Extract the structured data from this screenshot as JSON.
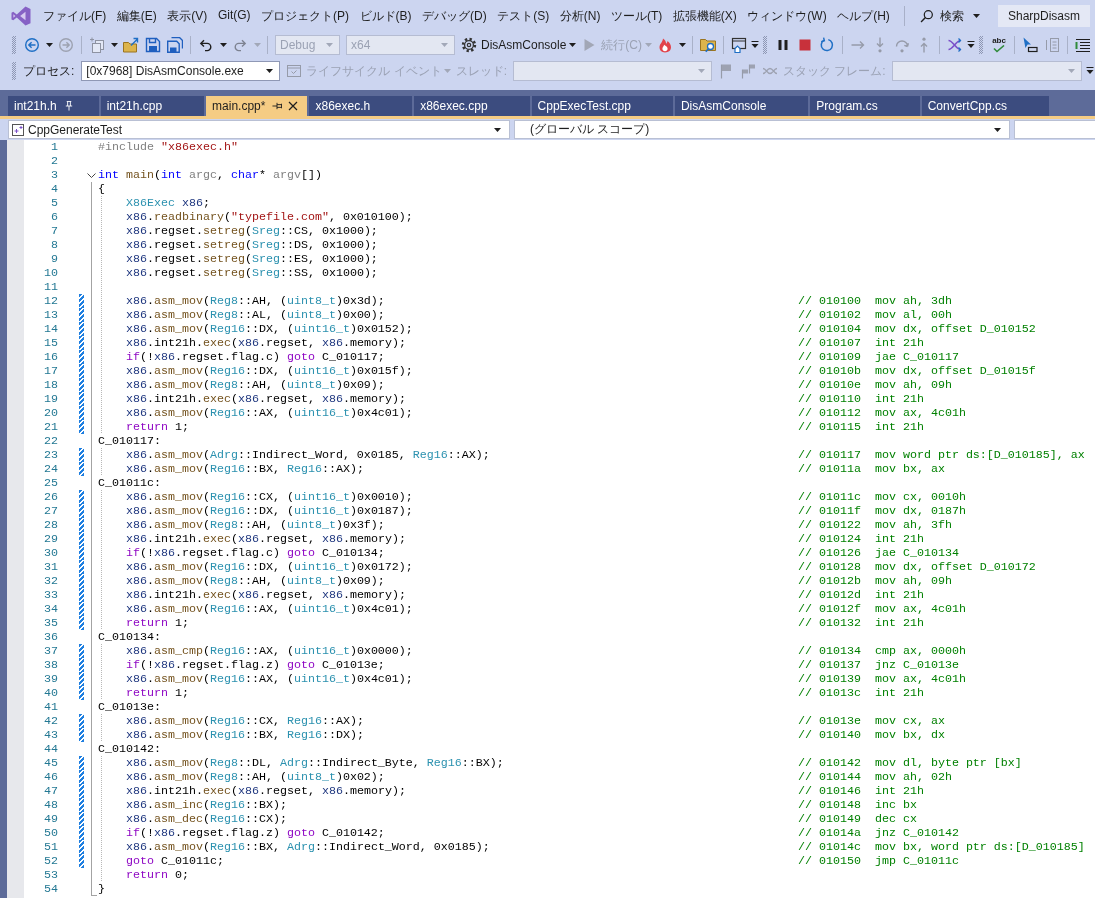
{
  "menu": {
    "items": [
      "ファイル(F)",
      "編集(E)",
      "表示(V)",
      "Git(G)",
      "プロジェクト(P)",
      "ビルド(B)",
      "デバッグ(D)",
      "テスト(S)",
      "分析(N)",
      "ツール(T)",
      "拡張機能(X)",
      "ウィンドウ(W)",
      "ヘルプ(H)"
    ],
    "search": "検索",
    "solution": "SharpDisasm"
  },
  "toolbar": [
    {
      "kind": "grip"
    },
    {
      "kind": "button",
      "disabled": false
    },
    {
      "kind": "caret",
      "disabled": false
    },
    {
      "kind": "button",
      "disabled": true
    },
    {
      "kind": "separator"
    },
    {
      "kind": "button",
      "disabled": true
    },
    {
      "kind": "caret",
      "disabled": false
    },
    {
      "kind": "button",
      "disabled": false
    },
    {
      "kind": "button",
      "disabled": false
    },
    {
      "kind": "button",
      "disabled": false
    },
    {
      "kind": "separator"
    },
    {
      "kind": "button",
      "disabled": false
    },
    {
      "kind": "caret",
      "disabled": false
    },
    {
      "kind": "button",
      "disabled": true
    },
    {
      "kind": "caret",
      "disabled": true
    },
    {
      "kind": "separator"
    },
    {
      "kind": "combo",
      "value": "Debug",
      "disabled": true
    },
    {
      "kind": "combo",
      "value": "x64",
      "disabled": true
    },
    {
      "kind": "text_button",
      "label": "DisAsmConsole",
      "disabled": false
    },
    {
      "kind": "caret",
      "disabled": false
    },
    {
      "kind": "text_button",
      "label": "続行(C)",
      "disabled": true
    },
    {
      "kind": "caret",
      "disabled": true
    },
    {
      "kind": "button",
      "disabled": false
    },
    {
      "kind": "caret",
      "disabled": false
    },
    {
      "kind": "separator"
    },
    {
      "kind": "button",
      "disabled": false
    },
    {
      "kind": "separator"
    },
    {
      "kind": "button",
      "disabled": false
    },
    {
      "kind": "overflow"
    },
    {
      "kind": "grip"
    },
    {
      "kind": "button",
      "disabled": false
    },
    {
      "kind": "button",
      "disabled": false
    },
    {
      "kind": "button",
      "disabled": false
    },
    {
      "kind": "separator"
    },
    {
      "kind": "button",
      "disabled": true
    },
    {
      "kind": "button",
      "disabled": true
    },
    {
      "kind": "button",
      "disabled": true
    },
    {
      "kind": "button",
      "disabled": true
    },
    {
      "kind": "separator"
    },
    {
      "kind": "button",
      "disabled": false
    },
    {
      "kind": "overflow"
    },
    {
      "kind": "grip"
    },
    {
      "kind": "stacked",
      "label": "abc",
      "disabled": false
    },
    {
      "kind": "separator"
    },
    {
      "kind": "button",
      "disabled": false
    },
    {
      "kind": "button",
      "disabled": true
    },
    {
      "kind": "separator"
    },
    {
      "kind": "button",
      "disabled": false
    }
  ],
  "debug_toolbar": [
    {
      "kind": "grip"
    },
    {
      "kind": "label",
      "text": "プロセス:",
      "disabled": false
    },
    {
      "kind": "combo",
      "value": "[0x7968] DisAsmConsole.exe",
      "disabled": false
    },
    {
      "kind": "text_button",
      "label": "ライフサイクル イベント",
      "disabled": true
    },
    {
      "kind": "caret",
      "disabled": true
    },
    {
      "kind": "label",
      "text": "スレッド:",
      "disabled": true
    },
    {
      "kind": "combo",
      "disabled": true
    },
    {
      "kind": "button",
      "disabled": true
    },
    {
      "kind": "button",
      "disabled": true
    },
    {
      "kind": "button",
      "disabled": true
    },
    {
      "kind": "label",
      "text": "スタック フレーム:",
      "disabled": true
    },
    {
      "kind": "combo",
      "disabled": true
    },
    {
      "kind": "overflow"
    }
  ],
  "tabs": [
    {
      "label": "int21h.h",
      "selected": false,
      "pinned": true
    },
    {
      "label": "int21h.cpp",
      "selected": false,
      "pinned": false
    },
    {
      "label": "main.cpp*",
      "selected": true,
      "pinned": false
    },
    {
      "label": "x86exec.h",
      "selected": false,
      "pinned": false
    },
    {
      "label": "x86exec.cpp",
      "selected": false,
      "pinned": false
    },
    {
      "label": "CppExecTest.cpp",
      "selected": false,
      "pinned": false
    },
    {
      "label": "DisAsmConsole",
      "selected": false,
      "pinned": false
    },
    {
      "label": "Program.cs",
      "selected": false,
      "pinned": false
    },
    {
      "label": "ConvertCpp.cs",
      "selected": false,
      "pinned": false
    }
  ],
  "navigation_bar": {
    "project": "CppGenerateTest",
    "scope": "(グローバル スコープ)"
  },
  "editor": {
    "lines": [
      {
        "number": "1",
        "changed": false,
        "indented": false,
        "code": [
          {
            "kind": "directive",
            "text": "#include"
          },
          {
            "kind": "string",
            "text": " \"x86exec.h\""
          }
        ]
      },
      {
        "number": "2",
        "changed": false,
        "indented": false
      },
      {
        "number": "3",
        "changed": false,
        "indented": false,
        "expanded": true,
        "code": [
          {
            "kind": "keyword",
            "text": "int"
          },
          {
            "kind": "function",
            "text": " main"
          },
          {
            "kind": "plain",
            "text": "("
          },
          {
            "kind": "keyword",
            "text": "int"
          },
          {
            "kind": "parameter",
            "text": " argc"
          },
          {
            "kind": "plain",
            "text": ", "
          },
          {
            "kind": "keyword",
            "text": "char"
          },
          {
            "kind": "plain",
            "text": "* "
          },
          {
            "kind": "parameter",
            "text": "argv"
          },
          {
            "kind": "plain",
            "text": "[])"
          }
        ]
      },
      {
        "number": "4",
        "changed": false,
        "indented": false,
        "code": [
          {
            "kind": "plain",
            "text": "{"
          }
        ]
      },
      {
        "number": "5",
        "changed": false,
        "indented": true,
        "code": [
          {
            "kind": "type",
            "text": "X86Exec"
          },
          {
            "kind": "variable",
            "text": " x86"
          },
          {
            "kind": "plain",
            "text": ";"
          }
        ]
      },
      {
        "number": "6",
        "changed": false,
        "indented": true,
        "code": [
          {
            "kind": "variable",
            "text": "x86"
          },
          {
            "kind": "plain",
            "text": "."
          },
          {
            "kind": "function",
            "text": "readbinary"
          },
          {
            "kind": "plain",
            "text": "("
          },
          {
            "kind": "string",
            "text": "\"typefile.com\""
          },
          {
            "kind": "plain",
            "text": ", 0x010100);"
          }
        ]
      },
      {
        "number": "7",
        "changed": false,
        "indented": true,
        "code": [
          {
            "kind": "variable",
            "text": "x86"
          },
          {
            "kind": "plain",
            "text": ".regset."
          },
          {
            "kind": "function",
            "text": "setreg"
          },
          {
            "kind": "plain",
            "text": "("
          },
          {
            "kind": "type",
            "text": "Sreg"
          },
          {
            "kind": "plain",
            "text": "::CS, 0x1000);"
          }
        ]
      },
      {
        "number": "8",
        "changed": false,
        "indented": true,
        "code": [
          {
            "kind": "variable",
            "text": "x86"
          },
          {
            "kind": "plain",
            "text": ".regset."
          },
          {
            "kind": "function",
            "text": "setreg"
          },
          {
            "kind": "plain",
            "text": "("
          },
          {
            "kind": "type",
            "text": "Sreg"
          },
          {
            "kind": "plain",
            "text": "::DS, 0x1000);"
          }
        ]
      },
      {
        "number": "9",
        "changed": false,
        "indented": true,
        "code": [
          {
            "kind": "variable",
            "text": "x86"
          },
          {
            "kind": "plain",
            "text": ".regset."
          },
          {
            "kind": "function",
            "text": "setreg"
          },
          {
            "kind": "plain",
            "text": "("
          },
          {
            "kind": "type",
            "text": "Sreg"
          },
          {
            "kind": "plain",
            "text": "::ES, 0x1000);"
          }
        ]
      },
      {
        "number": "10",
        "changed": false,
        "indented": true,
        "code": [
          {
            "kind": "variable",
            "text": "x86"
          },
          {
            "kind": "plain",
            "text": ".regset."
          },
          {
            "kind": "function",
            "text": "setreg"
          },
          {
            "kind": "plain",
            "text": "("
          },
          {
            "kind": "type",
            "text": "Sreg"
          },
          {
            "kind": "plain",
            "text": "::SS, 0x1000);"
          }
        ]
      },
      {
        "number": "11",
        "changed": false,
        "indented": true
      },
      {
        "number": "12",
        "changed": true,
        "indented": true,
        "code": [
          {
            "kind": "variable",
            "text": "x86"
          },
          {
            "kind": "plain",
            "text": "."
          },
          {
            "kind": "function",
            "text": "asm_mov"
          },
          {
            "kind": "plain",
            "text": "("
          },
          {
            "kind": "type",
            "text": "Reg8"
          },
          {
            "kind": "plain",
            "text": "::AH, ("
          },
          {
            "kind": "type",
            "text": "uint8_t"
          },
          {
            "kind": "plain",
            "text": ")0x3d);"
          }
        ],
        "comment": "// 010100  mov ah, 3dh"
      },
      {
        "number": "13",
        "changed": true,
        "indented": true,
        "code": [
          {
            "kind": "variable",
            "text": "x86"
          },
          {
            "kind": "plain",
            "text": "."
          },
          {
            "kind": "function",
            "text": "asm_mov"
          },
          {
            "kind": "plain",
            "text": "("
          },
          {
            "kind": "type",
            "text": "Reg8"
          },
          {
            "kind": "plain",
            "text": "::AL, ("
          },
          {
            "kind": "type",
            "text": "uint8_t"
          },
          {
            "kind": "plain",
            "text": ")0x00);"
          }
        ],
        "comment": "// 010102  mov al, 00h"
      },
      {
        "number": "14",
        "changed": true,
        "indented": true,
        "code": [
          {
            "kind": "variable",
            "text": "x86"
          },
          {
            "kind": "plain",
            "text": "."
          },
          {
            "kind": "function",
            "text": "asm_mov"
          },
          {
            "kind": "plain",
            "text": "("
          },
          {
            "kind": "type",
            "text": "Reg16"
          },
          {
            "kind": "plain",
            "text": "::DX, ("
          },
          {
            "kind": "type",
            "text": "uint16_t"
          },
          {
            "kind": "plain",
            "text": ")0x0152);"
          }
        ],
        "comment": "// 010104  mov dx, offset D_010152"
      },
      {
        "number": "15",
        "changed": true,
        "indented": true,
        "code": [
          {
            "kind": "variable",
            "text": "x86"
          },
          {
            "kind": "plain",
            "text": ".int21h."
          },
          {
            "kind": "function",
            "text": "exec"
          },
          {
            "kind": "plain",
            "text": "("
          },
          {
            "kind": "variable",
            "text": "x86"
          },
          {
            "kind": "plain",
            "text": ".regset, "
          },
          {
            "kind": "variable",
            "text": "x86"
          },
          {
            "kind": "plain",
            "text": ".memory);"
          }
        ],
        "comment": "// 010107  int 21h"
      },
      {
        "number": "16",
        "changed": true,
        "indented": true,
        "code": [
          {
            "kind": "control",
            "text": "if"
          },
          {
            "kind": "plain",
            "text": "(!"
          },
          {
            "kind": "variable",
            "text": "x86"
          },
          {
            "kind": "plain",
            "text": ".regset.flag.c) "
          },
          {
            "kind": "control",
            "text": "goto"
          },
          {
            "kind": "plain",
            "text": " C_010117;"
          }
        ],
        "comment": "// 010109  jae C_010117"
      },
      {
        "number": "17",
        "changed": true,
        "indented": true,
        "code": [
          {
            "kind": "variable",
            "text": "x86"
          },
          {
            "kind": "plain",
            "text": "."
          },
          {
            "kind": "function",
            "text": "asm_mov"
          },
          {
            "kind": "plain",
            "text": "("
          },
          {
            "kind": "type",
            "text": "Reg16"
          },
          {
            "kind": "plain",
            "text": "::DX, ("
          },
          {
            "kind": "type",
            "text": "uint16_t"
          },
          {
            "kind": "plain",
            "text": ")0x015f);"
          }
        ],
        "comment": "// 01010b  mov dx, offset D_01015f"
      },
      {
        "number": "18",
        "changed": true,
        "indented": true,
        "code": [
          {
            "kind": "variable",
            "text": "x86"
          },
          {
            "kind": "plain",
            "text": "."
          },
          {
            "kind": "function",
            "text": "asm_mov"
          },
          {
            "kind": "plain",
            "text": "("
          },
          {
            "kind": "type",
            "text": "Reg8"
          },
          {
            "kind": "plain",
            "text": "::AH, ("
          },
          {
            "kind": "type",
            "text": "uint8_t"
          },
          {
            "kind": "plain",
            "text": ")0x09);"
          }
        ],
        "comment": "// 01010e  mov ah, 09h"
      },
      {
        "number": "19",
        "changed": true,
        "indented": true,
        "code": [
          {
            "kind": "variable",
            "text": "x86"
          },
          {
            "kind": "plain",
            "text": ".int21h."
          },
          {
            "kind": "function",
            "text": "exec"
          },
          {
            "kind": "plain",
            "text": "("
          },
          {
            "kind": "variable",
            "text": "x86"
          },
          {
            "kind": "plain",
            "text": ".regset, "
          },
          {
            "kind": "variable",
            "text": "x86"
          },
          {
            "kind": "plain",
            "text": ".memory);"
          }
        ],
        "comment": "// 010110  int 21h"
      },
      {
        "number": "20",
        "changed": true,
        "indented": true,
        "code": [
          {
            "kind": "variable",
            "text": "x86"
          },
          {
            "kind": "plain",
            "text": "."
          },
          {
            "kind": "function",
            "text": "asm_mov"
          },
          {
            "kind": "plain",
            "text": "("
          },
          {
            "kind": "type",
            "text": "Reg16"
          },
          {
            "kind": "plain",
            "text": "::AX, ("
          },
          {
            "kind": "type",
            "text": "uint16_t"
          },
          {
            "kind": "plain",
            "text": ")0x4c01);"
          }
        ],
        "comment": "// 010112  mov ax, 4c01h"
      },
      {
        "number": "21",
        "changed": true,
        "indented": true,
        "code": [
          {
            "kind": "control",
            "text": "return"
          },
          {
            "kind": "plain",
            "text": " 1;"
          }
        ],
        "comment": "// 010115  int 21h"
      },
      {
        "number": "22",
        "changed": false,
        "indented": false,
        "code": [
          {
            "kind": "plain",
            "text": "C_010117:"
          }
        ]
      },
      {
        "number": "23",
        "changed": true,
        "indented": true,
        "code": [
          {
            "kind": "variable",
            "text": "x86"
          },
          {
            "kind": "plain",
            "text": "."
          },
          {
            "kind": "function",
            "text": "asm_mov"
          },
          {
            "kind": "plain",
            "text": "("
          },
          {
            "kind": "type",
            "text": "Adrg"
          },
          {
            "kind": "plain",
            "text": "::Indirect_Word, 0x0185, "
          },
          {
            "kind": "type",
            "text": "Reg16"
          },
          {
            "kind": "plain",
            "text": "::AX);"
          }
        ],
        "comment": "// 010117  mov word ptr ds:[D_010185], ax"
      },
      {
        "number": "24",
        "changed": true,
        "indented": true,
        "code": [
          {
            "kind": "variable",
            "text": "x86"
          },
          {
            "kind": "plain",
            "text": "."
          },
          {
            "kind": "function",
            "text": "asm_mov"
          },
          {
            "kind": "plain",
            "text": "("
          },
          {
            "kind": "type",
            "text": "Reg16"
          },
          {
            "kind": "plain",
            "text": "::BX, "
          },
          {
            "kind": "type",
            "text": "Reg16"
          },
          {
            "kind": "plain",
            "text": "::AX);"
          }
        ],
        "comment": "// 01011a  mov bx, ax"
      },
      {
        "number": "25",
        "changed": false,
        "indented": false,
        "code": [
          {
            "kind": "plain",
            "text": "C_01011c:"
          }
        ]
      },
      {
        "number": "26",
        "changed": true,
        "indented": true,
        "code": [
          {
            "kind": "variable",
            "text": "x86"
          },
          {
            "kind": "plain",
            "text": "."
          },
          {
            "kind": "function",
            "text": "asm_mov"
          },
          {
            "kind": "plain",
            "text": "("
          },
          {
            "kind": "type",
            "text": "Reg16"
          },
          {
            "kind": "plain",
            "text": "::CX, ("
          },
          {
            "kind": "type",
            "text": "uint16_t"
          },
          {
            "kind": "plain",
            "text": ")0x0010);"
          }
        ],
        "comment": "// 01011c  mov cx, 0010h"
      },
      {
        "number": "27",
        "changed": true,
        "indented": true,
        "code": [
          {
            "kind": "variable",
            "text": "x86"
          },
          {
            "kind": "plain",
            "text": "."
          },
          {
            "kind": "function",
            "text": "asm_mov"
          },
          {
            "kind": "plain",
            "text": "("
          },
          {
            "kind": "type",
            "text": "Reg16"
          },
          {
            "kind": "plain",
            "text": "::DX, ("
          },
          {
            "kind": "type",
            "text": "uint16_t"
          },
          {
            "kind": "plain",
            "text": ")0x0187);"
          }
        ],
        "comment": "// 01011f  mov dx, 0187h"
      },
      {
        "number": "28",
        "changed": true,
        "indented": true,
        "code": [
          {
            "kind": "variable",
            "text": "x86"
          },
          {
            "kind": "plain",
            "text": "."
          },
          {
            "kind": "function",
            "text": "asm_mov"
          },
          {
            "kind": "plain",
            "text": "("
          },
          {
            "kind": "type",
            "text": "Reg8"
          },
          {
            "kind": "plain",
            "text": "::AH, ("
          },
          {
            "kind": "type",
            "text": "uint8_t"
          },
          {
            "kind": "plain",
            "text": ")0x3f);"
          }
        ],
        "comment": "// 010122  mov ah, 3fh"
      },
      {
        "number": "29",
        "changed": true,
        "indented": true,
        "code": [
          {
            "kind": "variable",
            "text": "x86"
          },
          {
            "kind": "plain",
            "text": ".int21h."
          },
          {
            "kind": "function",
            "text": "exec"
          },
          {
            "kind": "plain",
            "text": "("
          },
          {
            "kind": "variable",
            "text": "x86"
          },
          {
            "kind": "plain",
            "text": ".regset, "
          },
          {
            "kind": "variable",
            "text": "x86"
          },
          {
            "kind": "plain",
            "text": ".memory);"
          }
        ],
        "comment": "// 010124  int 21h"
      },
      {
        "number": "30",
        "changed": true,
        "indented": true,
        "code": [
          {
            "kind": "control",
            "text": "if"
          },
          {
            "kind": "plain",
            "text": "(!"
          },
          {
            "kind": "variable",
            "text": "x86"
          },
          {
            "kind": "plain",
            "text": ".regset.flag.c) "
          },
          {
            "kind": "control",
            "text": "goto"
          },
          {
            "kind": "plain",
            "text": " C_010134;"
          }
        ],
        "comment": "// 010126  jae C_010134"
      },
      {
        "number": "31",
        "changed": true,
        "indented": true,
        "code": [
          {
            "kind": "variable",
            "text": "x86"
          },
          {
            "kind": "plain",
            "text": "."
          },
          {
            "kind": "function",
            "text": "asm_mov"
          },
          {
            "kind": "plain",
            "text": "("
          },
          {
            "kind": "type",
            "text": "Reg16"
          },
          {
            "kind": "plain",
            "text": "::DX, ("
          },
          {
            "kind": "type",
            "text": "uint16_t"
          },
          {
            "kind": "plain",
            "text": ")0x0172);"
          }
        ],
        "comment": "// 010128  mov dx, offset D_010172"
      },
      {
        "number": "32",
        "changed": true,
        "indented": true,
        "code": [
          {
            "kind": "variable",
            "text": "x86"
          },
          {
            "kind": "plain",
            "text": "."
          },
          {
            "kind": "function",
            "text": "asm_mov"
          },
          {
            "kind": "plain",
            "text": "("
          },
          {
            "kind": "type",
            "text": "Reg8"
          },
          {
            "kind": "plain",
            "text": "::AH, ("
          },
          {
            "kind": "type",
            "text": "uint8_t"
          },
          {
            "kind": "plain",
            "text": ")0x09);"
          }
        ],
        "comment": "// 01012b  mov ah, 09h"
      },
      {
        "number": "33",
        "changed": true,
        "indented": true,
        "code": [
          {
            "kind": "variable",
            "text": "x86"
          },
          {
            "kind": "plain",
            "text": ".int21h."
          },
          {
            "kind": "function",
            "text": "exec"
          },
          {
            "kind": "plain",
            "text": "("
          },
          {
            "kind": "variable",
            "text": "x86"
          },
          {
            "kind": "plain",
            "text": ".regset, "
          },
          {
            "kind": "variable",
            "text": "x86"
          },
          {
            "kind": "plain",
            "text": ".memory);"
          }
        ],
        "comment": "// 01012d  int 21h"
      },
      {
        "number": "34",
        "changed": true,
        "indented": true,
        "code": [
          {
            "kind": "variable",
            "text": "x86"
          },
          {
            "kind": "plain",
            "text": "."
          },
          {
            "kind": "function",
            "text": "asm_mov"
          },
          {
            "kind": "plain",
            "text": "("
          },
          {
            "kind": "type",
            "text": "Reg16"
          },
          {
            "kind": "plain",
            "text": "::AX, ("
          },
          {
            "kind": "type",
            "text": "uint16_t"
          },
          {
            "kind": "plain",
            "text": ")0x4c01);"
          }
        ],
        "comment": "// 01012f  mov ax, 4c01h"
      },
      {
        "number": "35",
        "changed": true,
        "indented": true,
        "code": [
          {
            "kind": "control",
            "text": "return"
          },
          {
            "kind": "plain",
            "text": " 1;"
          }
        ],
        "comment": "// 010132  int 21h"
      },
      {
        "number": "36",
        "changed": false,
        "indented": false,
        "code": [
          {
            "kind": "plain",
            "text": "C_010134:"
          }
        ]
      },
      {
        "number": "37",
        "changed": true,
        "indented": true,
        "code": [
          {
            "kind": "variable",
            "text": "x86"
          },
          {
            "kind": "plain",
            "text": "."
          },
          {
            "kind": "function",
            "text": "asm_cmp"
          },
          {
            "kind": "plain",
            "text": "("
          },
          {
            "kind": "type",
            "text": "Reg16"
          },
          {
            "kind": "plain",
            "text": "::AX, ("
          },
          {
            "kind": "type",
            "text": "uint16_t"
          },
          {
            "kind": "plain",
            "text": ")0x0000);"
          }
        ],
        "comment": "// 010134  cmp ax, 0000h"
      },
      {
        "number": "38",
        "changed": true,
        "indented": true,
        "code": [
          {
            "kind": "control",
            "text": "if"
          },
          {
            "kind": "plain",
            "text": "(!"
          },
          {
            "kind": "variable",
            "text": "x86"
          },
          {
            "kind": "plain",
            "text": ".regset.flag.z) "
          },
          {
            "kind": "control",
            "text": "goto"
          },
          {
            "kind": "plain",
            "text": " C_01013e;"
          }
        ],
        "comment": "// 010137  jnz C_01013e"
      },
      {
        "number": "39",
        "changed": true,
        "indented": true,
        "code": [
          {
            "kind": "variable",
            "text": "x86"
          },
          {
            "kind": "plain",
            "text": "."
          },
          {
            "kind": "function",
            "text": "asm_mov"
          },
          {
            "kind": "plain",
            "text": "("
          },
          {
            "kind": "type",
            "text": "Reg16"
          },
          {
            "kind": "plain",
            "text": "::AX, ("
          },
          {
            "kind": "type",
            "text": "uint16_t"
          },
          {
            "kind": "plain",
            "text": ")0x4c01);"
          }
        ],
        "comment": "// 010139  mov ax, 4c01h"
      },
      {
        "number": "40",
        "changed": true,
        "indented": true,
        "code": [
          {
            "kind": "control",
            "text": "return"
          },
          {
            "kind": "plain",
            "text": " 1;"
          }
        ],
        "comment": "// 01013c  int 21h"
      },
      {
        "number": "41",
        "changed": false,
        "indented": false,
        "code": [
          {
            "kind": "plain",
            "text": "C_01013e:"
          }
        ]
      },
      {
        "number": "42",
        "changed": true,
        "indented": true,
        "code": [
          {
            "kind": "variable",
            "text": "x86"
          },
          {
            "kind": "plain",
            "text": "."
          },
          {
            "kind": "function",
            "text": "asm_mov"
          },
          {
            "kind": "plain",
            "text": "("
          },
          {
            "kind": "type",
            "text": "Reg16"
          },
          {
            "kind": "plain",
            "text": "::CX, "
          },
          {
            "kind": "type",
            "text": "Reg16"
          },
          {
            "kind": "plain",
            "text": "::AX);"
          }
        ],
        "comment": "// 01013e  mov cx, ax"
      },
      {
        "number": "43",
        "changed": true,
        "indented": true,
        "code": [
          {
            "kind": "variable",
            "text": "x86"
          },
          {
            "kind": "plain",
            "text": "."
          },
          {
            "kind": "function",
            "text": "asm_mov"
          },
          {
            "kind": "plain",
            "text": "("
          },
          {
            "kind": "type",
            "text": "Reg16"
          },
          {
            "kind": "plain",
            "text": "::BX, "
          },
          {
            "kind": "type",
            "text": "Reg16"
          },
          {
            "kind": "plain",
            "text": "::DX);"
          }
        ],
        "comment": "// 010140  mov bx, dx"
      },
      {
        "number": "44",
        "changed": false,
        "indented": false,
        "code": [
          {
            "kind": "plain",
            "text": "C_010142:"
          }
        ]
      },
      {
        "number": "45",
        "changed": true,
        "indented": true,
        "code": [
          {
            "kind": "variable",
            "text": "x86"
          },
          {
            "kind": "plain",
            "text": "."
          },
          {
            "kind": "function",
            "text": "asm_mov"
          },
          {
            "kind": "plain",
            "text": "("
          },
          {
            "kind": "type",
            "text": "Reg8"
          },
          {
            "kind": "plain",
            "text": "::DL, "
          },
          {
            "kind": "type",
            "text": "Adrg"
          },
          {
            "kind": "plain",
            "text": "::Indirect_Byte, "
          },
          {
            "kind": "type",
            "text": "Reg16"
          },
          {
            "kind": "plain",
            "text": "::BX);"
          }
        ],
        "comment": "// 010142  mov dl, byte ptr [bx]"
      },
      {
        "number": "46",
        "changed": true,
        "indented": true,
        "code": [
          {
            "kind": "variable",
            "text": "x86"
          },
          {
            "kind": "plain",
            "text": "."
          },
          {
            "kind": "function",
            "text": "asm_mov"
          },
          {
            "kind": "plain",
            "text": "("
          },
          {
            "kind": "type",
            "text": "Reg8"
          },
          {
            "kind": "plain",
            "text": "::AH, ("
          },
          {
            "kind": "type",
            "text": "uint8_t"
          },
          {
            "kind": "plain",
            "text": ")0x02);"
          }
        ],
        "comment": "// 010144  mov ah, 02h"
      },
      {
        "number": "47",
        "changed": true,
        "indented": true,
        "code": [
          {
            "kind": "variable",
            "text": "x86"
          },
          {
            "kind": "plain",
            "text": ".int21h."
          },
          {
            "kind": "function",
            "text": "exec"
          },
          {
            "kind": "plain",
            "text": "("
          },
          {
            "kind": "variable",
            "text": "x86"
          },
          {
            "kind": "plain",
            "text": ".regset, "
          },
          {
            "kind": "variable",
            "text": "x86"
          },
          {
            "kind": "plain",
            "text": ".memory);"
          }
        ],
        "comment": "// 010146  int 21h"
      },
      {
        "number": "48",
        "changed": true,
        "indented": true,
        "code": [
          {
            "kind": "variable",
            "text": "x86"
          },
          {
            "kind": "plain",
            "text": "."
          },
          {
            "kind": "function",
            "text": "asm_inc"
          },
          {
            "kind": "plain",
            "text": "("
          },
          {
            "kind": "type",
            "text": "Reg16"
          },
          {
            "kind": "plain",
            "text": "::BX);"
          }
        ],
        "comment": "// 010148  inc bx"
      },
      {
        "number": "49",
        "changed": true,
        "indented": true,
        "code": [
          {
            "kind": "variable",
            "text": "x86"
          },
          {
            "kind": "plain",
            "text": "."
          },
          {
            "kind": "function",
            "text": "asm_dec"
          },
          {
            "kind": "plain",
            "text": "("
          },
          {
            "kind": "type",
            "text": "Reg16"
          },
          {
            "kind": "plain",
            "text": "::CX);"
          }
        ],
        "comment": "// 010149  dec cx"
      },
      {
        "number": "50",
        "changed": true,
        "indented": true,
        "code": [
          {
            "kind": "control",
            "text": "if"
          },
          {
            "kind": "plain",
            "text": "(!"
          },
          {
            "kind": "variable",
            "text": "x86"
          },
          {
            "kind": "plain",
            "text": ".regset.flag.z) "
          },
          {
            "kind": "control",
            "text": "goto"
          },
          {
            "kind": "plain",
            "text": " C_010142;"
          }
        ],
        "comment": "// 01014a  jnz C_010142"
      },
      {
        "number": "51",
        "changed": true,
        "indented": true,
        "code": [
          {
            "kind": "variable",
            "text": "x86"
          },
          {
            "kind": "plain",
            "text": "."
          },
          {
            "kind": "function",
            "text": "asm_mov"
          },
          {
            "kind": "plain",
            "text": "("
          },
          {
            "kind": "type",
            "text": "Reg16"
          },
          {
            "kind": "plain",
            "text": "::BX, "
          },
          {
            "kind": "type",
            "text": "Adrg"
          },
          {
            "kind": "plain",
            "text": "::Indirect_Word, 0x0185);"
          }
        ],
        "comment": "// 01014c  mov bx, word ptr ds:[D_010185]"
      },
      {
        "number": "52",
        "changed": true,
        "indented": true,
        "code": [
          {
            "kind": "control",
            "text": "goto"
          },
          {
            "kind": "plain",
            "text": " C_01011c;"
          }
        ],
        "comment": "// 010150  jmp C_01011c"
      },
      {
        "number": "53",
        "changed": false,
        "indented": true,
        "code": [
          {
            "kind": "control",
            "text": "return"
          },
          {
            "kind": "plain",
            "text": " 0;"
          }
        ]
      },
      {
        "number": "54",
        "changed": false,
        "indented": false,
        "code": [
          {
            "kind": "plain",
            "text": "}"
          }
        ]
      }
    ]
  }
}
